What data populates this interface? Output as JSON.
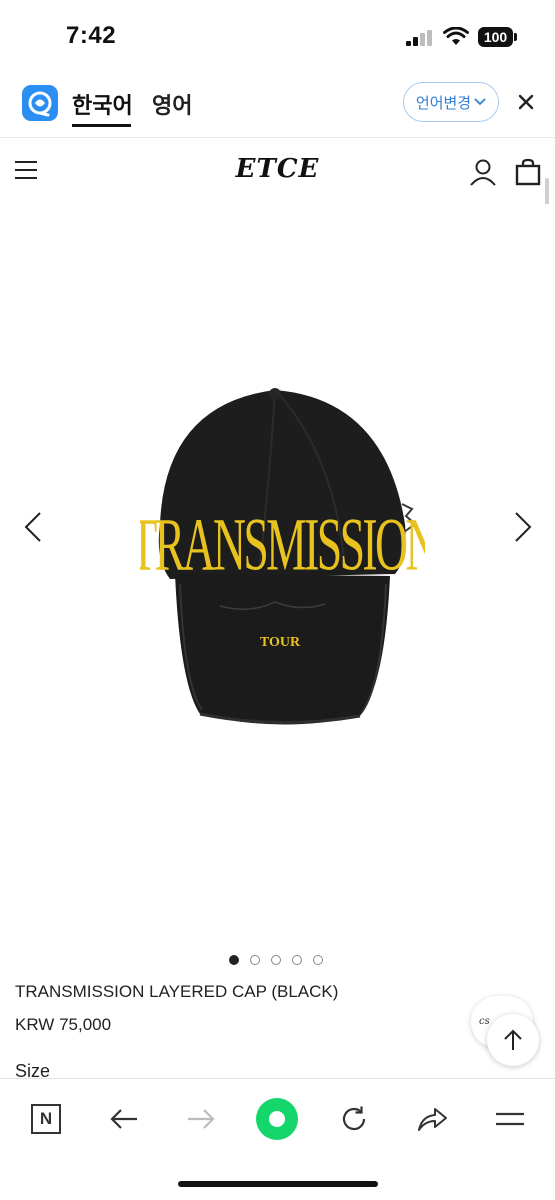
{
  "status_bar": {
    "time": "7:42",
    "battery": "100"
  },
  "translate_bar": {
    "tab_korean": "한국어",
    "tab_english": "영어",
    "change_language": "언어변경"
  },
  "header": {
    "brand": "ETCE"
  },
  "gallery": {
    "cap_text_main": "TRANSMISSION",
    "cap_text_sub": "TOUR",
    "slide_count": 5,
    "active_slide": 1
  },
  "product": {
    "name": "TRANSMISSION LAYERED CAP (BLACK)",
    "price": "KRW 75,000",
    "size_label": "Size"
  },
  "floating": {
    "cs_label": "cs"
  },
  "toolbar": {
    "n_label": "N"
  },
  "colors": {
    "accent_blue": "#2f7fd8",
    "green_button": "#15d66a",
    "embroidery_yellow": "#e8c21f"
  }
}
